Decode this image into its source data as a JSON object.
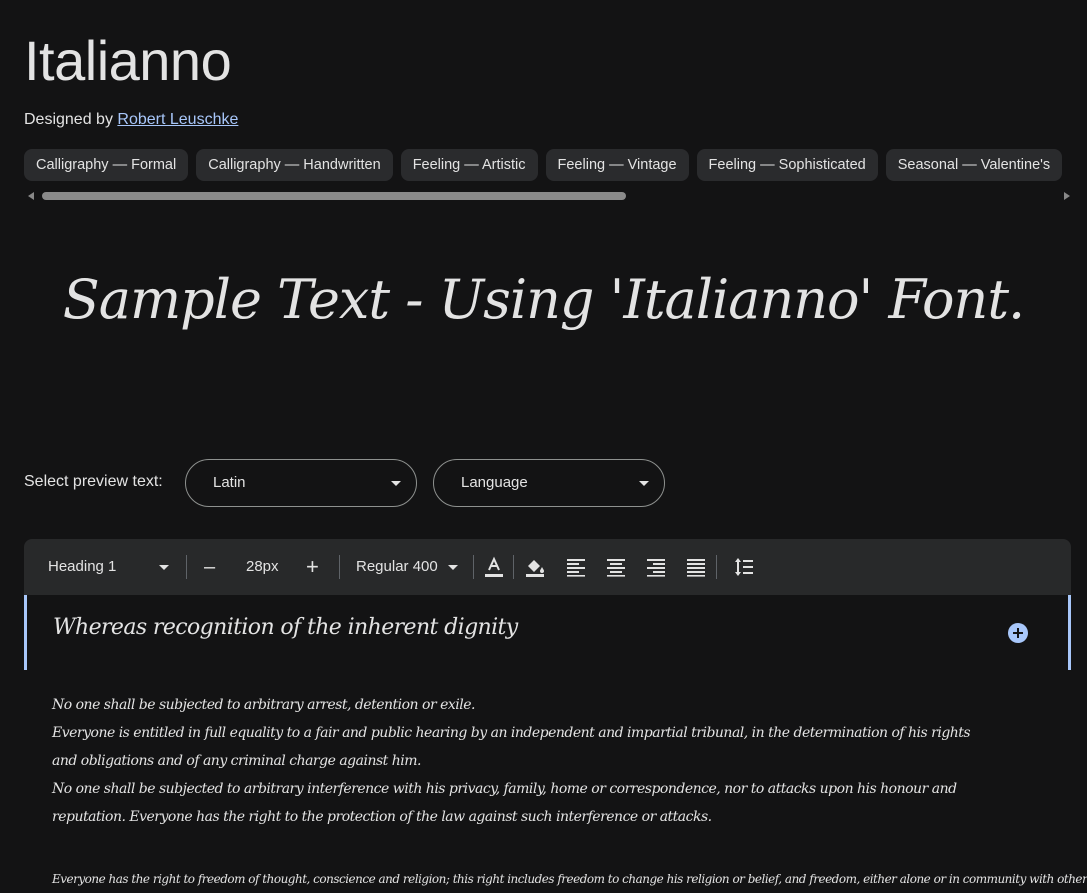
{
  "font": {
    "name": "Italianno",
    "designed_by_label": "Designed by",
    "designer": "Robert Leuschke"
  },
  "tags": [
    "Calligraphy — Formal",
    "Calligraphy — Handwritten",
    "Feeling — Artistic",
    "Feeling — Vintage",
    "Feeling — Sophisticated",
    "Seasonal — Valentine's"
  ],
  "sample_text": "Sample Text - Using 'Italianno' Font.",
  "preview": {
    "label": "Select preview text:",
    "script_select": "Latin",
    "language_select": "Language"
  },
  "toolbar": {
    "style": "Heading 1",
    "minus": "–",
    "size": "28px",
    "plus": "+",
    "weight": "Regular 400"
  },
  "editor": {
    "heading": "Whereas recognition of the inherent dignity",
    "paragraphs": [
      "No one shall be subjected to arbitrary arrest, detention or exile.",
      "Everyone is entitled in full equality to a fair and public hearing by an independent and impartial tribunal, in the determination of his rights and obligations and of any criminal charge against him.",
      "No one shall be subjected to arbitrary interference with his privacy, family, home or correspondence, nor to attacks upon his honour and reputation. Everyone has the right to the protection of the law against such interference or attacks."
    ],
    "paragraph_2": "Everyone has the right to freedom of thought, conscience and religion; this right includes freedom to change his religion or belief, and freedom, either alone or in community with others and in public or"
  },
  "colors": {
    "background": "#131314",
    "chip": "#2a2b2d",
    "toolbar": "#28292a",
    "accent": "#a8c7fa",
    "text": "#e3e3e3"
  }
}
